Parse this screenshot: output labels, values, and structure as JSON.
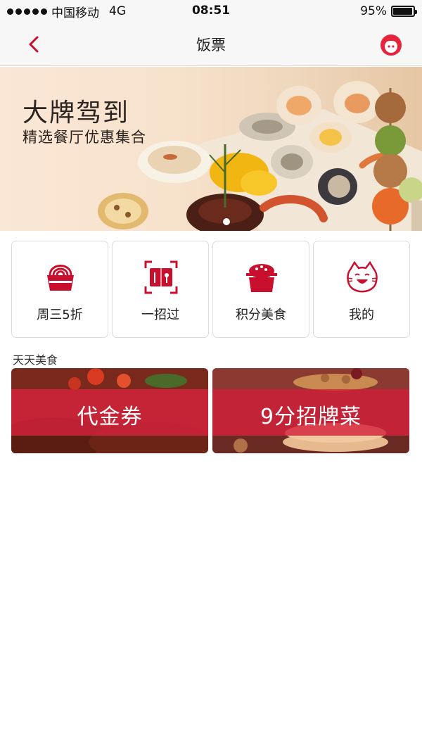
{
  "status_bar": {
    "carrier": "中国移动",
    "network": "4G",
    "time": "08:51",
    "battery_percent": "95%",
    "battery_level": 0.95
  },
  "nav": {
    "title": "饭票",
    "back_icon": "chevron-left-icon",
    "service_icon": "customer-service-icon"
  },
  "banner": {
    "title": "大牌驾到",
    "subtitle": "精选餐厅优惠集合"
  },
  "quick_menu": [
    {
      "label": "周三5折",
      "icon": "noodle-bowl-icon"
    },
    {
      "label": "一招过",
      "icon": "ticket-scan-icon"
    },
    {
      "label": "积分美食",
      "icon": "rice-box-icon"
    },
    {
      "label": "我的",
      "icon": "cat-face-icon"
    }
  ],
  "section": {
    "title": "天天美食",
    "cards": [
      {
        "label": "代金券"
      },
      {
        "label": "9分招牌菜"
      }
    ]
  },
  "colors": {
    "accent": "#c8102e",
    "card_band": "#d6223c"
  }
}
